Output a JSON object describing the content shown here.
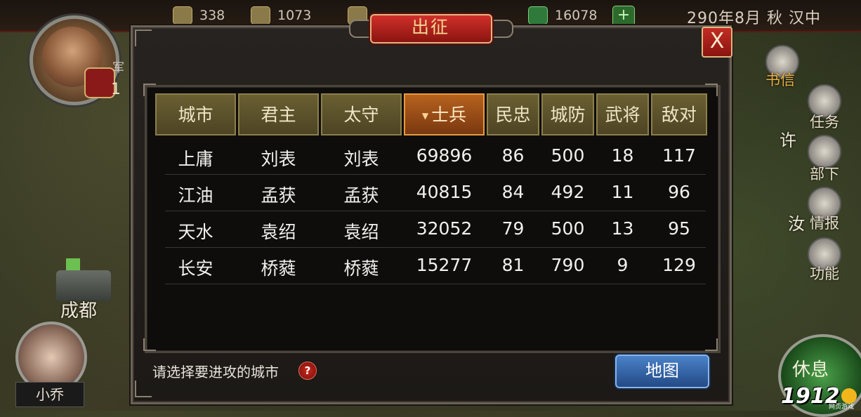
{
  "topbar": {
    "resources": [
      {
        "icon": "grain-icon",
        "value": "338"
      },
      {
        "icon": "coin-icon",
        "value": "1073"
      },
      {
        "icon": "scroll-icon",
        "value": ""
      },
      {
        "icon": "jade-icon",
        "value": "16078"
      }
    ],
    "date": "290年8月 秋 汉中"
  },
  "player": {
    "rank_digit": "1",
    "title_fragment": "军"
  },
  "map": {
    "left_city": "成都",
    "companion_name": "小乔",
    "right_labels": [
      "许",
      "汝"
    ]
  },
  "side_menu": {
    "items": [
      {
        "label": "书信",
        "icon": "letter-icon"
      },
      {
        "label": "任务",
        "icon": "flag-icon"
      },
      {
        "label": "部下",
        "icon": "troops-icon"
      },
      {
        "label": "情报",
        "icon": "intel-icon"
      },
      {
        "label": "功能",
        "icon": "gear-icon"
      }
    ],
    "rest_label": "休息"
  },
  "watermark": {
    "text": "1912",
    "sub": "网页游戏"
  },
  "modal": {
    "title": "出征",
    "close_label": "X",
    "columns": [
      "城市",
      "君主",
      "太守",
      "士兵",
      "民忠",
      "城防",
      "武将",
      "敌对"
    ],
    "sorted_column": "士兵",
    "rows": [
      [
        "上庸",
        "刘表",
        "刘表",
        "69896",
        "86",
        "500",
        "18",
        "117"
      ],
      [
        "江油",
        "孟获",
        "孟获",
        "40815",
        "84",
        "492",
        "11",
        "96"
      ],
      [
        "天水",
        "袁绍",
        "袁绍",
        "32052",
        "79",
        "500",
        "13",
        "95"
      ],
      [
        "长安",
        "桥蕤",
        "桥蕤",
        "15277",
        "81",
        "790",
        "9",
        "129"
      ]
    ],
    "hint": "请选择要进攻的城市",
    "help_label": "?",
    "map_button": "地图"
  }
}
